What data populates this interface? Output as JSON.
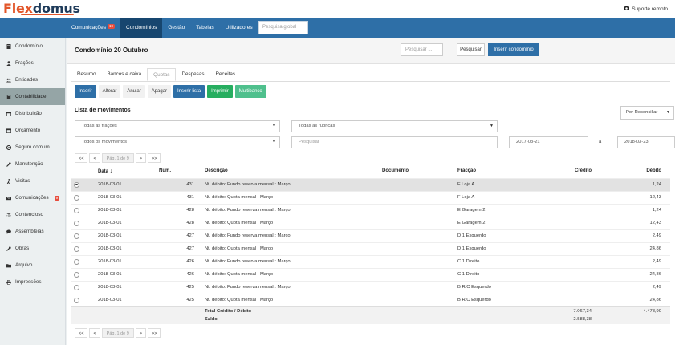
{
  "header": {
    "logo_part1": "Flex",
    "logo_part2": "domus",
    "support_label": "Suporte remoto"
  },
  "nav": {
    "tabs": [
      {
        "label": "Comunicações",
        "badge": "19"
      },
      {
        "label": "Condomínios"
      },
      {
        "label": "Gestão"
      },
      {
        "label": "Tabelas"
      },
      {
        "label": "Utilizadores"
      }
    ],
    "active_tab": "Condomínios",
    "search_placeholder": "Pesquisa global"
  },
  "sidebar": {
    "items": [
      {
        "label": "Condomínio",
        "icon": "building-icon"
      },
      {
        "label": "Frações",
        "icon": "user-icon"
      },
      {
        "label": "Entidades",
        "icon": "users-icon"
      },
      {
        "label": "Contabilidade",
        "icon": "book-icon",
        "active": true
      },
      {
        "label": "Distribuição",
        "icon": "calendar-icon"
      },
      {
        "label": "Orçamento",
        "icon": "calendar-icon"
      },
      {
        "label": "Seguro comum",
        "icon": "lifebuoy-icon"
      },
      {
        "label": "Manutenção",
        "icon": "wrench-icon"
      },
      {
        "label": "Visitas",
        "icon": "walking-icon"
      },
      {
        "label": "Comunicações",
        "icon": "envelope-icon",
        "badge": "9"
      },
      {
        "label": "Contencioso",
        "icon": "scales-icon"
      },
      {
        "label": "Assembleias",
        "icon": "chat-icon"
      },
      {
        "label": "Obras",
        "icon": "wrench-icon"
      },
      {
        "label": "Arquivo",
        "icon": "folder-icon"
      },
      {
        "label": "Impressões",
        "icon": "print-icon"
      }
    ]
  },
  "main": {
    "title": "Condomínio 20 Outubro",
    "search_placeholder": "Pesquisar ...",
    "search_button": "Pesquisar",
    "insert_condo_button": "Inserir condomínio",
    "subtabs": [
      "Resumo",
      "Bancos e caixa",
      "Quotas",
      "Despesas",
      "Receitas"
    ],
    "active_subtab": "Quotas",
    "actions": {
      "inserir": "Inserir",
      "alterar": "Alterar",
      "anular": "Anular",
      "apagar": "Apagar",
      "inserir_lista": "Inserir lista",
      "imprimir": "Imprimir",
      "multibanco": "Multibanco"
    },
    "section_title": "Lista de movimentos",
    "reconcile_select": "Por Reconciliar",
    "filters": {
      "fracoes": "Todas as frações",
      "rubricas": "Todas as rúbricas",
      "movimentos": "Todos os movimentos",
      "search_placeholder": "Pesquisar",
      "date_from": "2017-03-21",
      "date_sep": "a",
      "date_to": "2018-03-23"
    },
    "pager": {
      "first": "<<",
      "prev": "<",
      "page": "Pág. 1 de 9",
      "next": ">",
      "last": ">>"
    },
    "table": {
      "columns": {
        "data": "Data",
        "num": "Num.",
        "descricao": "Descrição",
        "documento": "Documento",
        "fracao": "Fracção",
        "credito": "Crédito",
        "debito": "Débito"
      },
      "rows": [
        {
          "data": "2018-03-01",
          "num": "431",
          "descricao": "Nt. débito: Fundo reserva mensal : Março",
          "documento": "",
          "fracao": "F Loja A",
          "credito": "",
          "debito": "1,24",
          "selected": true
        },
        {
          "data": "2018-03-01",
          "num": "431",
          "descricao": "Nt. débito: Quota mensal : Março",
          "documento": "",
          "fracao": "F Loja A",
          "credito": "",
          "debito": "12,43"
        },
        {
          "data": "2018-03-01",
          "num": "428",
          "descricao": "Nt. débito: Fundo reserva mensal : Março",
          "documento": "",
          "fracao": "E Garagem 2",
          "credito": "",
          "debito": "1,24"
        },
        {
          "data": "2018-03-01",
          "num": "428",
          "descricao": "Nt. débito: Quota mensal : Março",
          "documento": "",
          "fracao": "E Garagem 2",
          "credito": "",
          "debito": "12,43"
        },
        {
          "data": "2018-03-01",
          "num": "427",
          "descricao": "Nt. débito: Fundo reserva mensal : Março",
          "documento": "",
          "fracao": "D 1 Esquerdo",
          "credito": "",
          "debito": "2,49"
        },
        {
          "data": "2018-03-01",
          "num": "427",
          "descricao": "Nt. débito: Quota mensal : Março",
          "documento": "",
          "fracao": "D 1 Esquerdo",
          "credito": "",
          "debito": "24,86"
        },
        {
          "data": "2018-03-01",
          "num": "426",
          "descricao": "Nt. débito: Fundo reserva mensal : Março",
          "documento": "",
          "fracao": "C 1 Direito",
          "credito": "",
          "debito": "2,49"
        },
        {
          "data": "2018-03-01",
          "num": "426",
          "descricao": "Nt. débito: Quota mensal : Março",
          "documento": "",
          "fracao": "C 1 Direito",
          "credito": "",
          "debito": "24,86"
        },
        {
          "data": "2018-03-01",
          "num": "425",
          "descricao": "Nt. débito: Fundo reserva mensal : Março",
          "documento": "",
          "fracao": "B R/C Esquerdo",
          "credito": "",
          "debito": "2,49"
        },
        {
          "data": "2018-03-01",
          "num": "425",
          "descricao": "Nt. débito: Quota mensal : Março",
          "documento": "",
          "fracao": "B R/C Esquerdo",
          "credito": "",
          "debito": "24,86"
        }
      ],
      "total_label": "Total Crédito / Débito",
      "total_credito": "7.067,34",
      "total_debito": "4.478,90",
      "saldo_label": "Saldo",
      "saldo_value": "2.588,38"
    }
  },
  "colors": {
    "nav_blue": "#2e6fa7",
    "nav_active": "#17466f",
    "logo_orange": "#e2562a",
    "logo_navy": "#1f3b5a",
    "green": "#27ae60",
    "light_green": "#4fc08d",
    "badge_red": "#e74c3c"
  }
}
